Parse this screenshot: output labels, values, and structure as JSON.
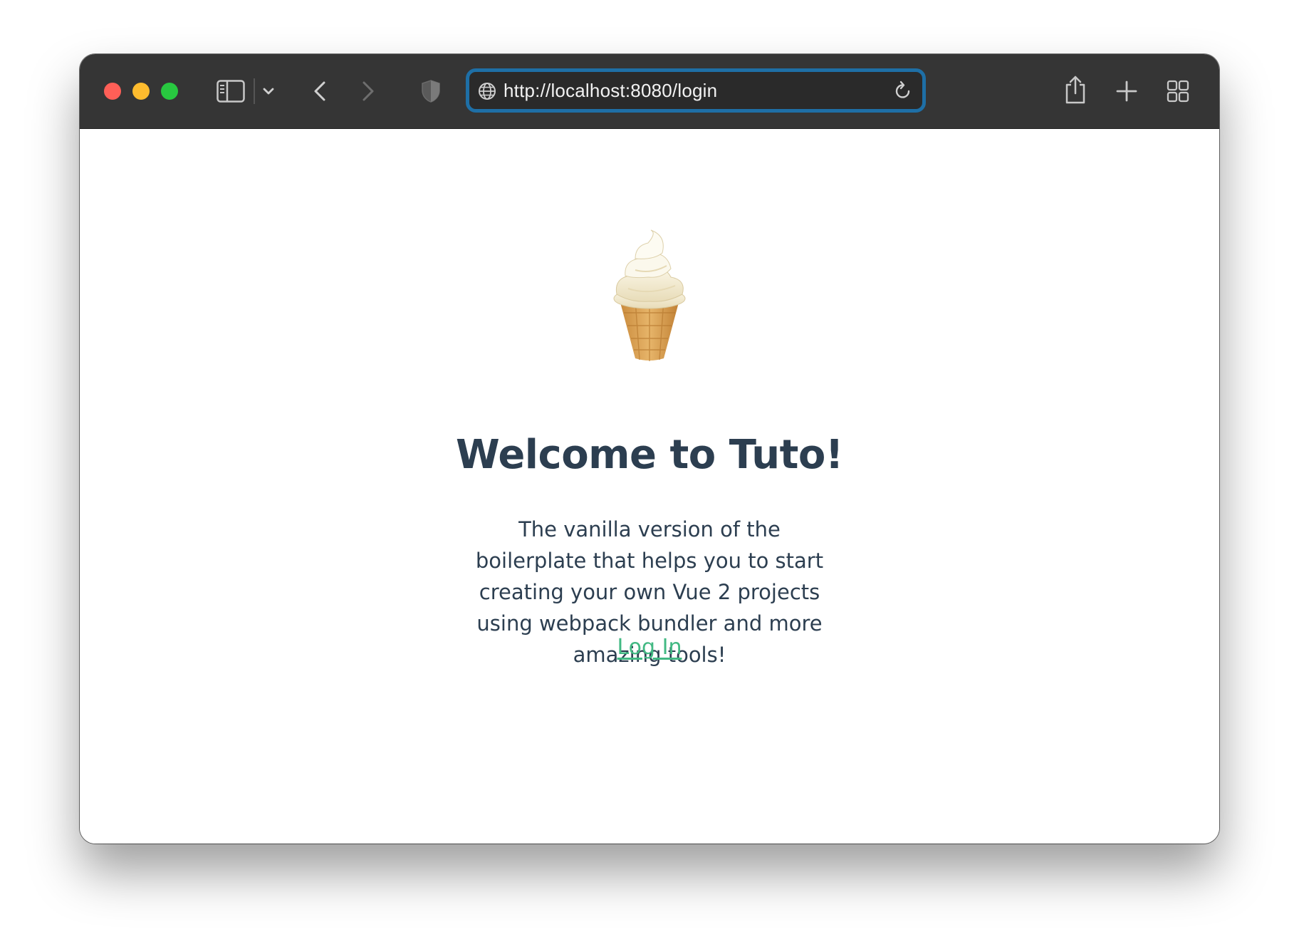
{
  "browser": {
    "url": "http://localhost:8080/login",
    "icons": [
      "close-icon",
      "minimize-icon",
      "zoom-icon",
      "sidebar-icon",
      "chevron-down-icon",
      "back-icon",
      "forward-icon",
      "shield-icon",
      "globe-icon",
      "reload-icon",
      "share-icon",
      "plus-icon",
      "tabs-grid-icon"
    ],
    "colors": {
      "toolbar": "#353535",
      "close": "#ff5f57",
      "minimize": "#febc2e",
      "zoom": "#28c840",
      "focus_ring": "#1e6fa6"
    }
  },
  "page": {
    "logo_icon": "ice-cream-cone-icon",
    "title": "Welcome to Tuto!",
    "description": "The vanilla version of the boilerplate that helps you to start creating your own Vue 2 projects using webpack bundler and more amazing tools!",
    "login_link": "Log In",
    "colors": {
      "text": "#2c3e50",
      "link": "#42b983"
    }
  }
}
